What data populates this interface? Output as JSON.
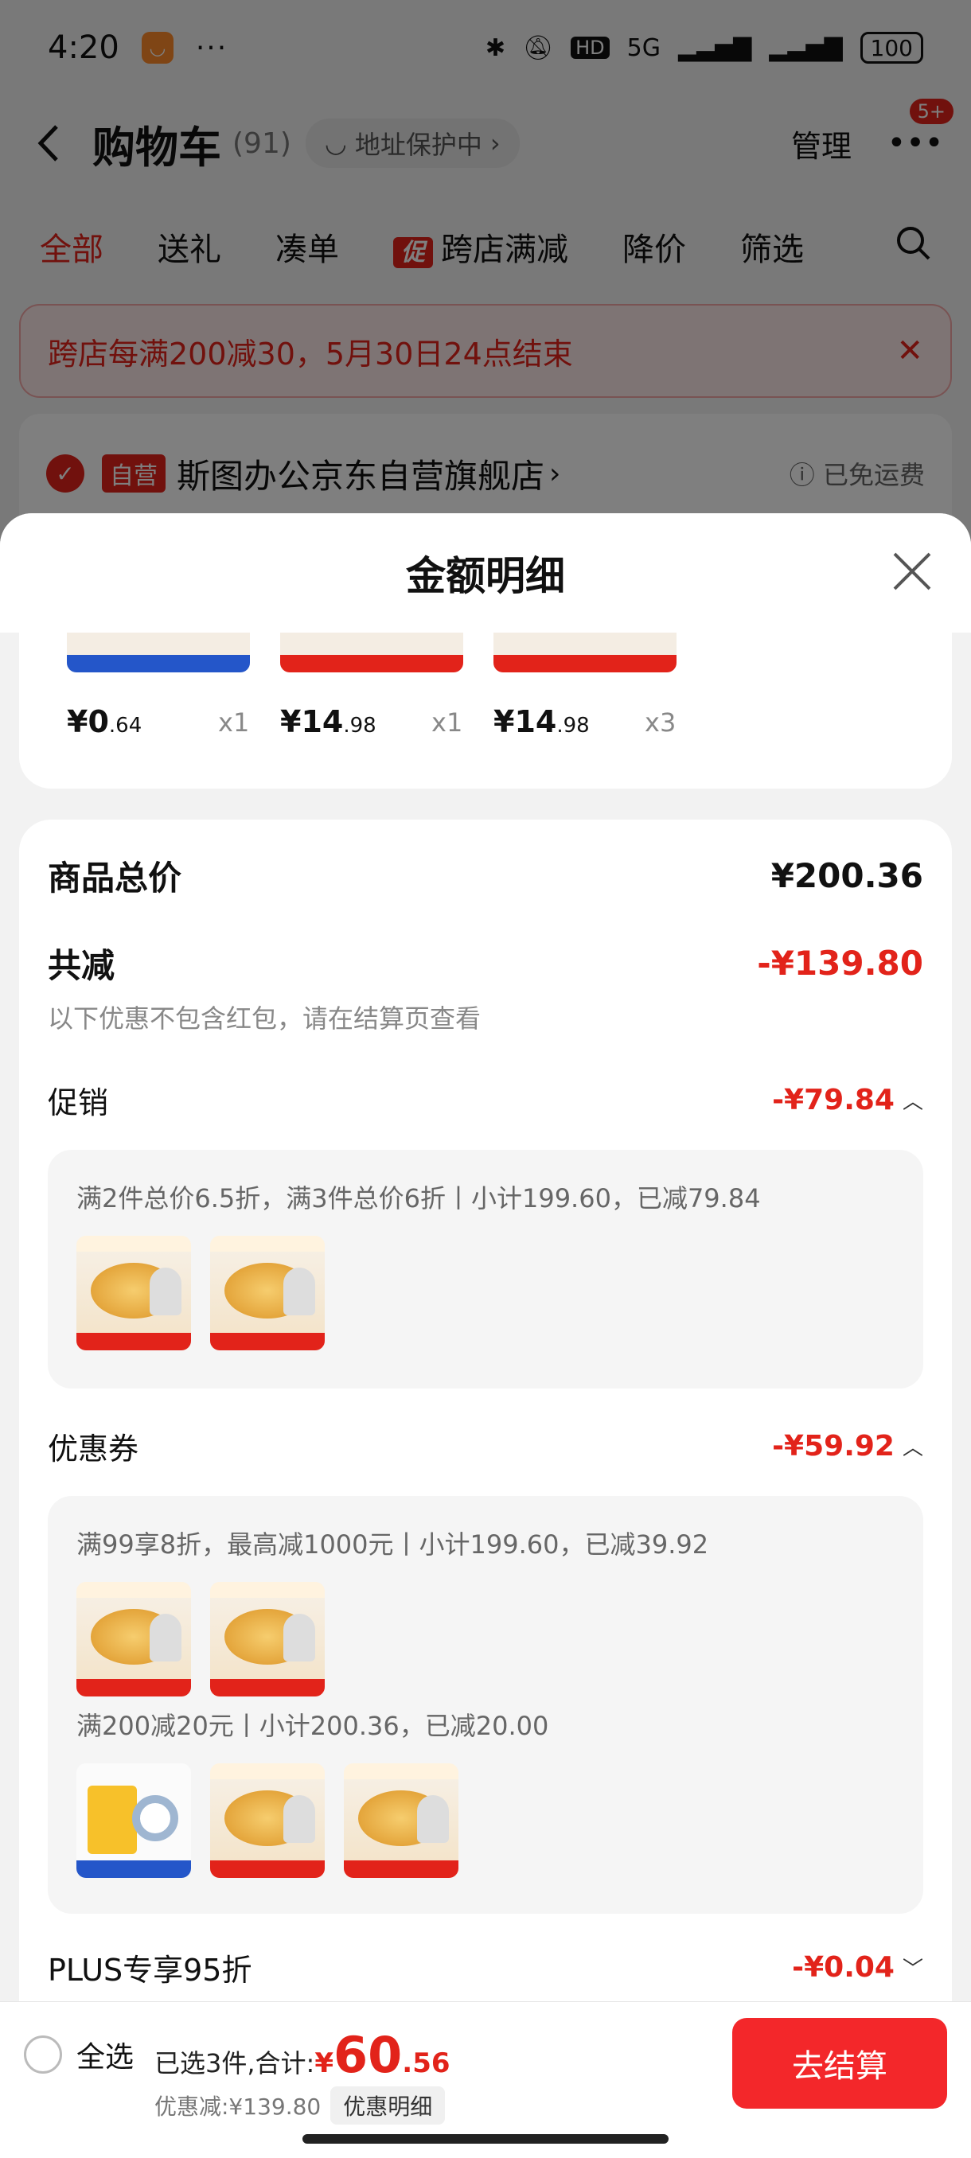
{
  "status_bar": {
    "time": "4:20",
    "dots": "···",
    "network": "5G",
    "battery": "100"
  },
  "nav": {
    "title": "购物车",
    "count": "(91)",
    "address": "地址保护中",
    "manage": "管理",
    "badge": "5+"
  },
  "tabs": [
    {
      "label": "全部"
    },
    {
      "label": "送礼"
    },
    {
      "label": "凑单"
    },
    {
      "label": "跨店满减",
      "tag": "促"
    },
    {
      "label": "降价"
    },
    {
      "label": "筛选"
    }
  ],
  "notice": {
    "text": "跨店每满200减30，5月30日24点结束"
  },
  "store": {
    "self_tag": "自营",
    "name": "斯图办公京东自营旗舰店",
    "shipping": "已免运费"
  },
  "sheet": {
    "title": "金额明细",
    "items": [
      {
        "price_int": "¥0",
        "price_cents": ".64",
        "qty": "x1"
      },
      {
        "price_int": "¥14",
        "price_cents": ".98",
        "qty": "x1"
      },
      {
        "price_int": "¥14",
        "price_cents": ".98",
        "qty": "x3"
      }
    ],
    "goods_total": {
      "label": "商品总价",
      "value": "¥200.36"
    },
    "total_discount": {
      "label": "共减",
      "value": "-¥139.80",
      "note": "以下优惠不包含红包，请在结算页查看"
    },
    "promotion": {
      "label": "促销",
      "value": "-¥79.84",
      "detail": "满2件总价6.5折，满3件总价6折丨小计199.60，已减79.84"
    },
    "coupon": {
      "label": "优惠券",
      "value": "-¥59.92",
      "detail1": "满99享8折，最高减1000元丨小计199.60，已减39.92",
      "detail2": "满200减20元丨小计200.36，已减20.00"
    },
    "plus": {
      "label": "PLUS专享95折",
      "value": "-¥0.04"
    }
  },
  "action_bar": {
    "select_all": "全选",
    "selected_text": "已选3件,合计:",
    "currency": "¥",
    "total_int": "60",
    "total_cents": ".56",
    "discount_text": "优惠减:¥139.80",
    "detail_button": "优惠明细",
    "checkout": "去结算"
  },
  "colors": {
    "accent": "#e2231a",
    "checkout": "#f3272a"
  }
}
